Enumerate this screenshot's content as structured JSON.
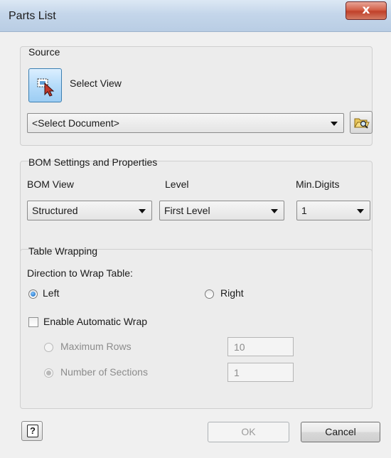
{
  "window": {
    "title": "Parts List",
    "close_glyph": "x"
  },
  "source": {
    "group_title": "Source",
    "select_view_label": "Select View",
    "select_view_icon": "select-view-cursor-icon",
    "document_combo_value": "<Select Document>",
    "browse_icon": "open-folder-icon"
  },
  "bom": {
    "group_title": "BOM Settings and Properties",
    "bom_view_label": "BOM View",
    "bom_view_value": "Structured",
    "level_label": "Level",
    "level_value": "First Level",
    "min_digits_label": "Min.Digits",
    "min_digits_value": "1"
  },
  "wrapping": {
    "group_title": "Table Wrapping",
    "direction_label": "Direction to Wrap Table:",
    "left_label": "Left",
    "right_label": "Right",
    "direction_selected": "Left",
    "auto_wrap_label": "Enable Automatic Wrap",
    "auto_wrap_checked": false,
    "max_rows_label": "Maximum Rows",
    "max_rows_value": "10",
    "num_sections_label": "Number of Sections",
    "num_sections_value": "1"
  },
  "footer": {
    "help_glyph": "?",
    "ok_label": "OK",
    "cancel_label": "Cancel"
  },
  "colors": {
    "accent": "#3c7fb1",
    "close_red": "#c0412a",
    "titlebar": "#c4d6ea"
  }
}
